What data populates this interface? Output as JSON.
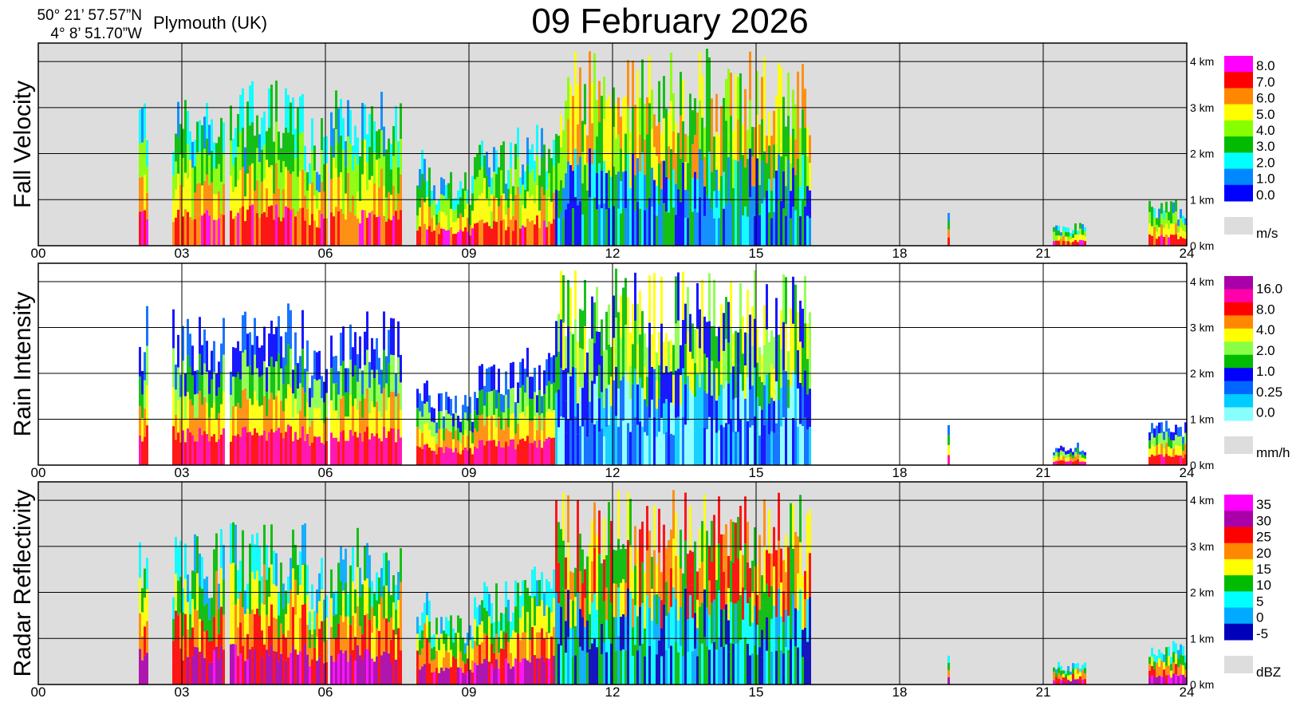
{
  "header": {
    "lat": "50° 21’ 57.57”N",
    "lon": "4°  8’ 51.70”W",
    "location": "Plymouth (UK)",
    "title": "09 February  2026"
  },
  "colors": {
    "panel_bg_grey": "#dddddd",
    "grid": "#000000"
  },
  "chart_data": [
    {
      "type": "heatmap",
      "panel": "Fall Velocity",
      "ylabel": "Fall Velocity",
      "x_ticks": [
        "00",
        "03",
        "06",
        "09",
        "12",
        "15",
        "18",
        "21",
        "24"
      ],
      "y_ticks": [
        "0 km",
        "1 km",
        "2 km",
        "3 km",
        "4 km"
      ],
      "xlim": [
        0,
        24
      ],
      "ylim_km": [
        0,
        4.4
      ],
      "background": "grey",
      "colorbar": {
        "unit": "m/s",
        "labels": [
          "8.0",
          "7.0",
          "6.0",
          "5.0",
          "4.0",
          "3.0",
          "2.0",
          "1.0",
          "0.0"
        ],
        "colors": [
          "#ff00ff",
          "#ff0000",
          "#ff8800",
          "#ffff00",
          "#88ff00",
          "#00bb00",
          "#00ffff",
          "#0088ff",
          "#0000ff"
        ]
      }
    },
    {
      "type": "heatmap",
      "panel": "Rain Intensity",
      "ylabel": "Rain Intensity",
      "x_ticks": [
        "00",
        "03",
        "06",
        "09",
        "12",
        "15",
        "18",
        "21",
        "24"
      ],
      "y_ticks": [
        "0 km",
        "1 km",
        "2 km",
        "3 km",
        "4 km"
      ],
      "xlim": [
        0,
        24
      ],
      "ylim_km": [
        0,
        4.4
      ],
      "background": "white",
      "colorbar": {
        "unit": "mm/h",
        "labels": [
          "16.0",
          "8.0",
          "4.0",
          "2.0",
          "1.0",
          "0.25",
          "0.0"
        ],
        "colors": [
          "#aa00aa",
          "#ff00aa",
          "#ff0000",
          "#ff8800",
          "#ffff00",
          "#88ff44",
          "#00bb00",
          "#0000ff",
          "#0066ff",
          "#00ccff",
          "#88ffff"
        ]
      }
    },
    {
      "type": "heatmap",
      "panel": "Radar Reflectivity",
      "ylabel": "Radar Reflectivity",
      "x_ticks": [
        "00",
        "03",
        "06",
        "09",
        "12",
        "15",
        "18",
        "21",
        "24"
      ],
      "y_ticks": [
        "0 km",
        "1 km",
        "2 km",
        "3 km",
        "4 km"
      ],
      "xlim": [
        0,
        24
      ],
      "ylim_km": [
        0,
        4.4
      ],
      "background": "grey",
      "colorbar": {
        "unit": "dBZ",
        "labels": [
          "35",
          "30",
          "25",
          "20",
          "15",
          "10",
          "5",
          "0",
          "-5"
        ],
        "colors": [
          "#ff00ff",
          "#aa00aa",
          "#ff0000",
          "#ff8800",
          "#ffff00",
          "#00bb00",
          "#00ffff",
          "#00aaff",
          "#0000bb"
        ]
      }
    }
  ]
}
